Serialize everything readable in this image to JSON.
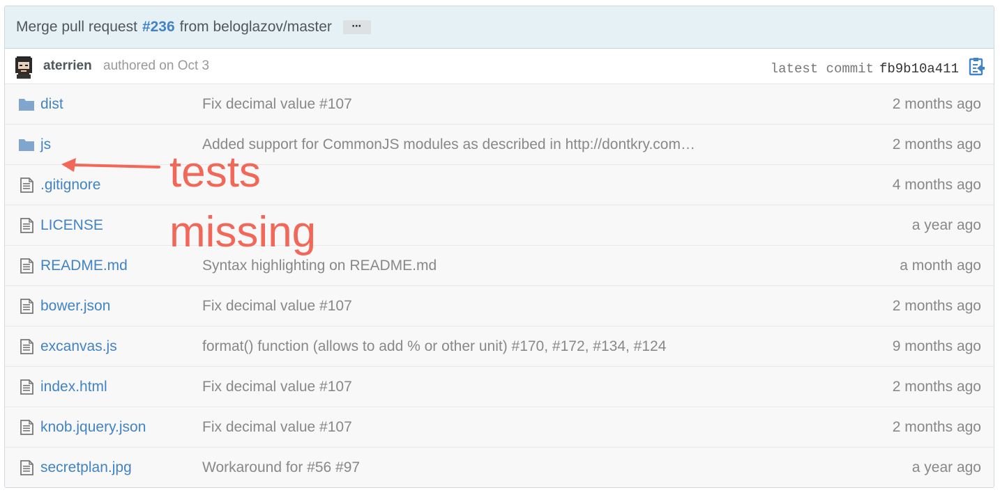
{
  "commit": {
    "title_prefix": "Merge pull request",
    "pr_number": "#236",
    "title_suffix": "from beloglazov/master",
    "ellipsis": "⋯",
    "author": "aterrien",
    "authored": "authored on Oct 3",
    "latest_label": "latest commit",
    "sha": "fb9b10a411"
  },
  "files": [
    {
      "type": "folder",
      "name": "dist",
      "message": "Fix decimal value #107",
      "age": "2 months ago"
    },
    {
      "type": "folder",
      "name": "js",
      "message": "Added support for CommonJS modules as described in http://dontkry.com…",
      "age": "2 months ago"
    },
    {
      "type": "file",
      "name": ".gitignore",
      "message": "",
      "age": "4 months ago"
    },
    {
      "type": "file",
      "name": "LICENSE",
      "message": "",
      "age": "a year ago"
    },
    {
      "type": "file",
      "name": "README.md",
      "message": "Syntax highlighting on README.md",
      "age": "a month ago"
    },
    {
      "type": "file",
      "name": "bower.json",
      "message": "Fix decimal value #107",
      "age": "2 months ago"
    },
    {
      "type": "file",
      "name": "excanvas.js",
      "message": "format() function (allows to add % or other unit) #170, #172, #134, #124",
      "age": "9 months ago"
    },
    {
      "type": "file",
      "name": "index.html",
      "message": "Fix decimal value #107",
      "age": "2 months ago"
    },
    {
      "type": "file",
      "name": "knob.jquery.json",
      "message": "Fix decimal value #107",
      "age": "2 months ago"
    },
    {
      "type": "file",
      "name": "secretplan.jpg",
      "message": "Workaround for #56 #97",
      "age": "a year ago"
    }
  ],
  "annotation": {
    "line1": "tests",
    "line2": "missing",
    "color": "#f26758"
  },
  "colors": {
    "link": "#4183c4",
    "header_bg": "#e6f1f6",
    "list_bg": "#f8f8f8",
    "folder": "#80a6cd"
  }
}
